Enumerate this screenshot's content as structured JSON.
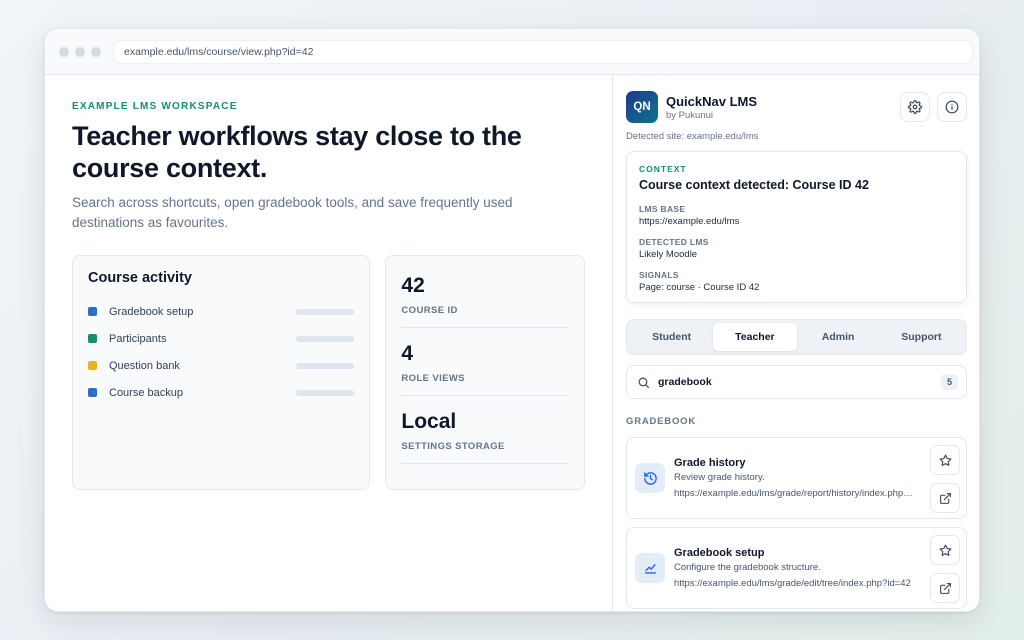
{
  "browser": {
    "url": "example.edu/lms/course/view.php?id=42"
  },
  "hero": {
    "eyebrow": "EXAMPLE LMS WORKSPACE",
    "headline": "Teacher workflows stay close to the course context.",
    "lead": "Search across shortcuts, open gradebook tools, and save frequently used destinations as favourites."
  },
  "activity": {
    "title": "Course activity",
    "items": [
      {
        "label": "Gradebook setup",
        "color": "#2f6ec2"
      },
      {
        "label": "Participants",
        "color": "#14906f"
      },
      {
        "label": "Question bank",
        "color": "#e9b228"
      },
      {
        "label": "Course backup",
        "color": "#2f6ec2"
      }
    ]
  },
  "stats": [
    {
      "value": "42",
      "label": "COURSE ID"
    },
    {
      "value": "4",
      "label": "ROLE VIEWS"
    },
    {
      "value": "Local",
      "label": "SETTINGS STORAGE"
    }
  ],
  "extension": {
    "logo": "QN",
    "name": "QuickNav LMS",
    "by": "by Pukunui",
    "detected_site": "Detected site: example.edu/lms",
    "context": {
      "eyebrow": "CONTEXT",
      "title": "Course context detected: Course ID 42",
      "lms_base_label": "LMS BASE",
      "lms_base": "https://example.edu/lms",
      "detected_lms_label": "DETECTED LMS",
      "detected_lms": "Likely Moodle",
      "signals_label": "SIGNALS",
      "signals": "Page: course · Course ID 42"
    },
    "tabs": [
      "Student",
      "Teacher",
      "Admin",
      "Support"
    ],
    "active_tab": "Teacher",
    "search": {
      "value": "gradebook",
      "count": "5"
    },
    "section": "GRADEBOOK",
    "results": [
      {
        "title": "Grade history",
        "desc": "Review grade history.",
        "url": "https://example.edu/lms/grade/report/history/index.php?id=42",
        "icon": "history-icon"
      },
      {
        "title": "Gradebook setup",
        "desc": "Configure the gradebook structure.",
        "url": "https://example.edu/lms/grade/edit/tree/index.php?id=42",
        "icon": "chart-line-icon"
      }
    ]
  }
}
